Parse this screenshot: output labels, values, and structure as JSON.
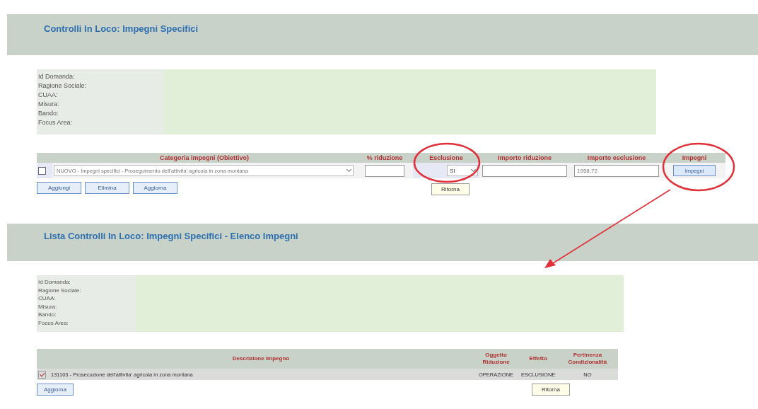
{
  "form": {
    "title": "Controlli In Loco: Impegni Specifici",
    "info_labels": [
      "Id Domanda:",
      "Ragione Sociale:",
      "CUAA:",
      "Misura:",
      "Bando:",
      "Focus Area:"
    ],
    "columns": [
      "Categoria impegni (Obiettivo)",
      "% riduzione",
      "Esclusione",
      "Importo riduzione",
      "Importo esclusione",
      "Impegni"
    ],
    "rows": [
      {
        "checked": false,
        "categoria": "NUOVO - Impegni specifici - Proseguimento dell'attivita' agricola in zona montana",
        "riduzione": "",
        "esclusione": "SI",
        "importo_riduzione": "",
        "importo_esclusione": "1958,72",
        "button": "Impegni"
      }
    ],
    "buttons": [
      "Aggiungi",
      "Elimina",
      "Aggiorna"
    ],
    "back": "Ritorna"
  },
  "list": {
    "title": "Lista Controlli In Loco: Impegni Specifici - Elenco Impegni",
    "info_labels": [
      "Id Domanda:",
      "Ragione Sociale:",
      "CUAA:",
      "Misura:",
      "Bando:",
      "Focus Area:"
    ],
    "columns": [
      "Descrizione Impegno",
      "Oggetto Riduzione",
      "Effetto",
      "Pertinenza Condizionalità"
    ],
    "rows": [
      {
        "checked": true,
        "cells": [
          "131103 - Prosecuzione dell'attivita' agricola in zona montana",
          "OPERAZIONE",
          "ESCLUSIONE",
          "NO"
        ]
      }
    ],
    "buttons": [
      "Aggiorna"
    ],
    "back": "Ritorna"
  }
}
